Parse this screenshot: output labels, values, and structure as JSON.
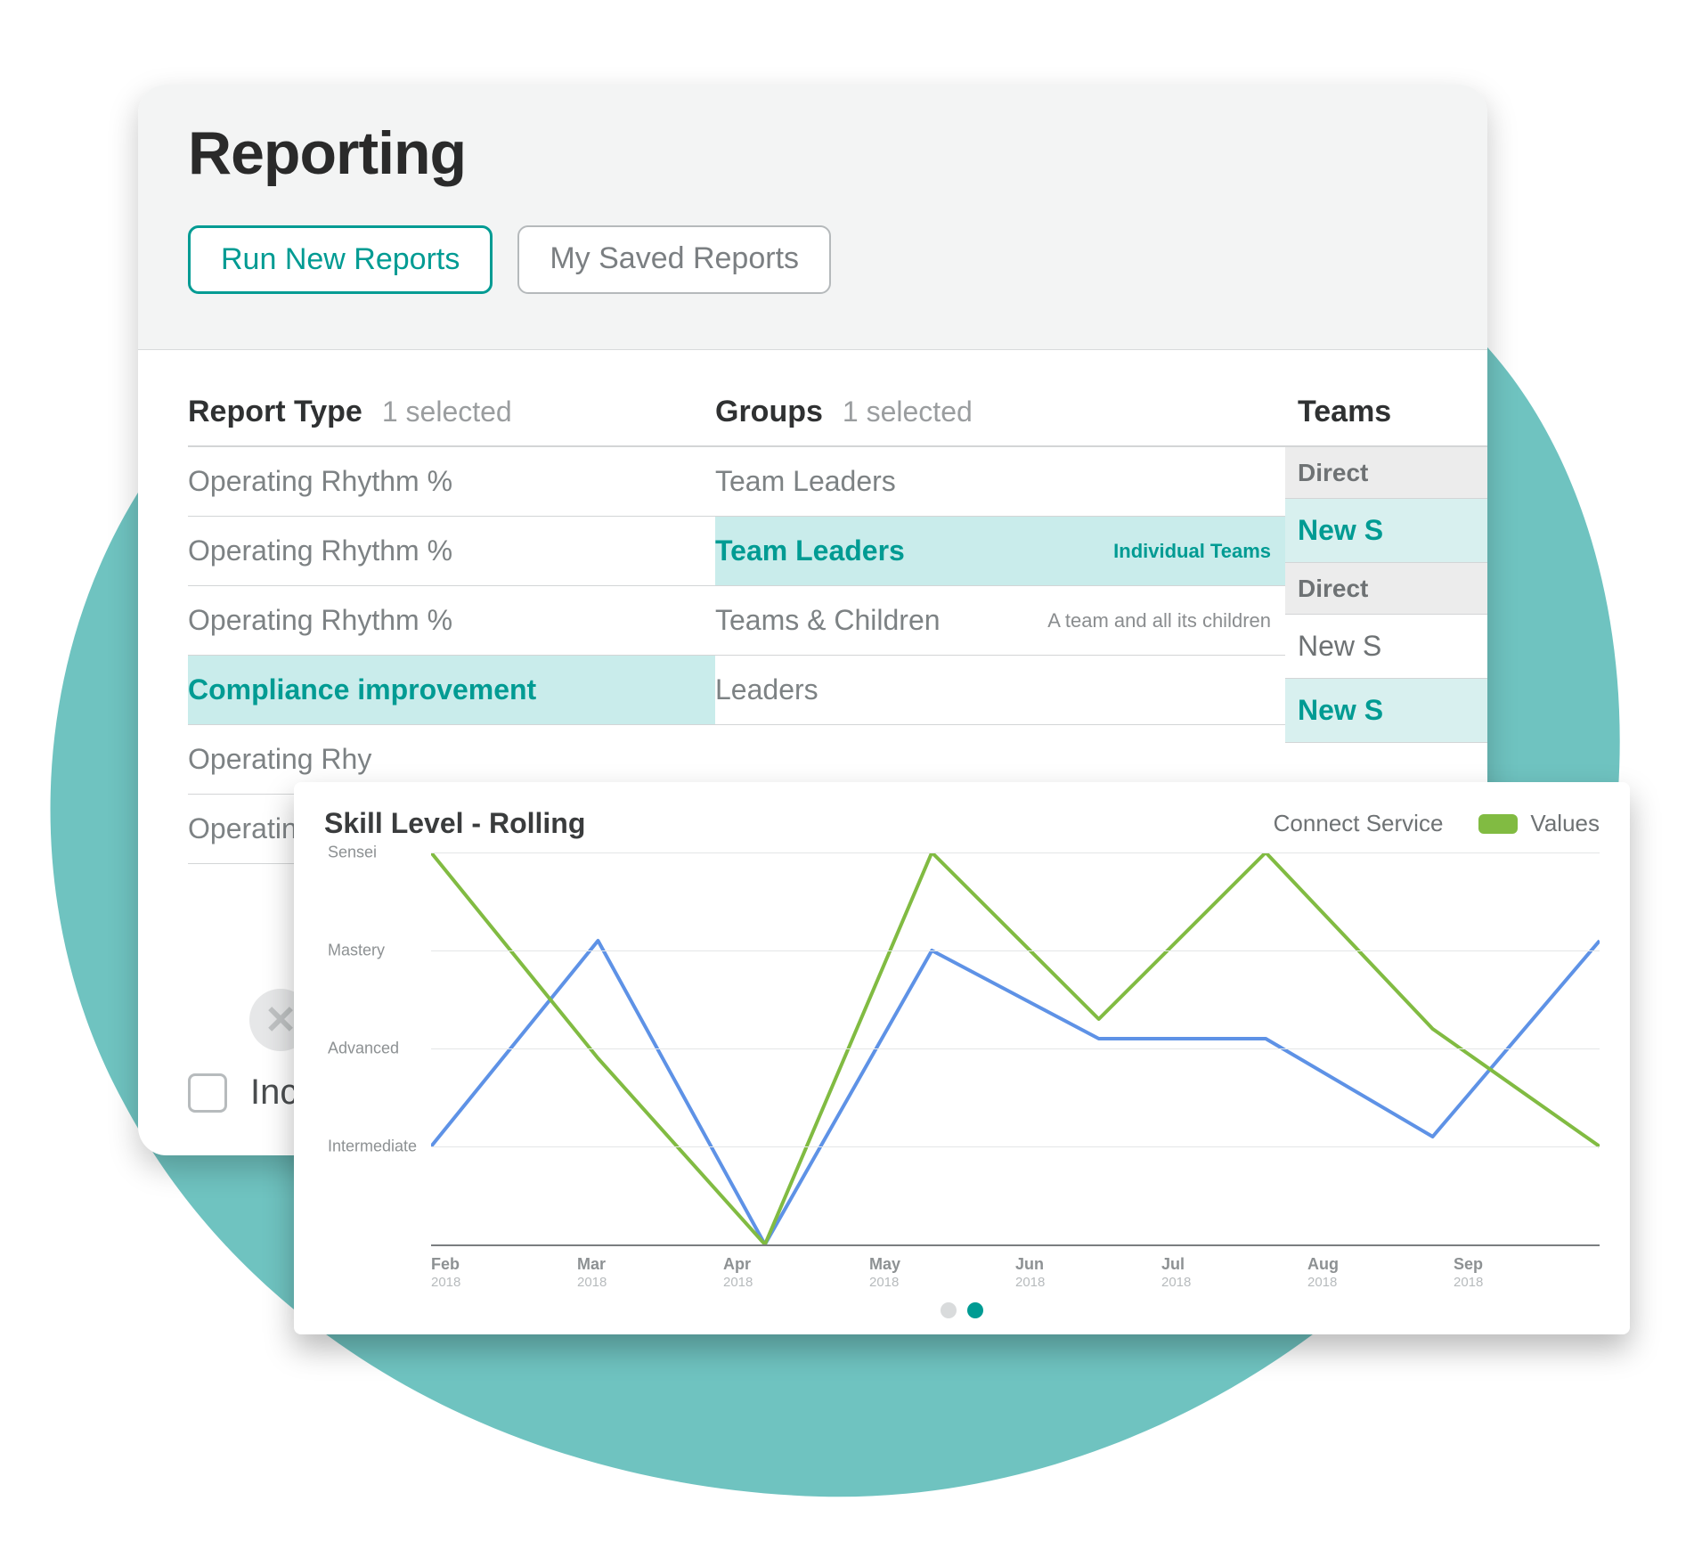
{
  "colors": {
    "teal": "#009b93",
    "tealSoft": "#6fc3c0",
    "blue": "#5e92e6",
    "green": "#81bb42",
    "greyText": "#7d8284"
  },
  "header": {
    "title": "Reporting",
    "tabs": {
      "run": "Run New Reports",
      "saved": "My Saved Reports"
    }
  },
  "reportType": {
    "label": "Report Type",
    "count": "1 selected",
    "items": [
      {
        "name": "Operating Rhythm %",
        "selected": false
      },
      {
        "name": "Operating Rhythm %",
        "selected": false
      },
      {
        "name": "Operating Rhythm %",
        "selected": false
      },
      {
        "name": "Compliance improvement",
        "selected": true
      },
      {
        "name": "Operating Rhy",
        "selected": false
      },
      {
        "name": "Operating Rhy",
        "selected": false
      }
    ]
  },
  "groups": {
    "label": "Groups",
    "count": "1 selected",
    "items": [
      {
        "name": "Team Leaders",
        "sub": "",
        "selected": false
      },
      {
        "name": "Team Leaders",
        "sub": "Individual Teams",
        "selected": true
      },
      {
        "name": "Teams & Children",
        "sub": "A team and all its children",
        "selected": false
      },
      {
        "name": "Leaders",
        "sub": "",
        "selected": false
      }
    ]
  },
  "teams": {
    "label": "Teams",
    "rows": [
      {
        "kind": "sub-head",
        "name": "Direct"
      },
      {
        "kind": "teal",
        "name": "New S"
      },
      {
        "kind": "sub-head",
        "name": "Direct"
      },
      {
        "kind": "plain",
        "name": "New S"
      },
      {
        "kind": "teal",
        "name": "New S"
      }
    ]
  },
  "include": {
    "label": "Include"
  },
  "chart_data": {
    "type": "line",
    "title": "Skill Level - Rolling",
    "ylevels": [
      "Sensei",
      "Mastery",
      "Advanced",
      "Intermediate"
    ],
    "ylim": [
      0,
      4
    ],
    "categories": [
      "Feb",
      "Mar",
      "Apr",
      "May",
      "Jun",
      "Jul",
      "Aug",
      "Sep"
    ],
    "x_year": "2018",
    "series": [
      {
        "name": "Connect Service",
        "color": "#5e92e6",
        "values": [
          1.0,
          3.1,
          0.0,
          3.0,
          2.1,
          2.1,
          1.1,
          3.1
        ]
      },
      {
        "name": "Values",
        "color": "#81bb42",
        "values": [
          4.0,
          1.9,
          0.0,
          4.0,
          2.3,
          4.0,
          2.2,
          1.0
        ]
      }
    ],
    "pager": {
      "total": 2,
      "active": 1
    }
  }
}
